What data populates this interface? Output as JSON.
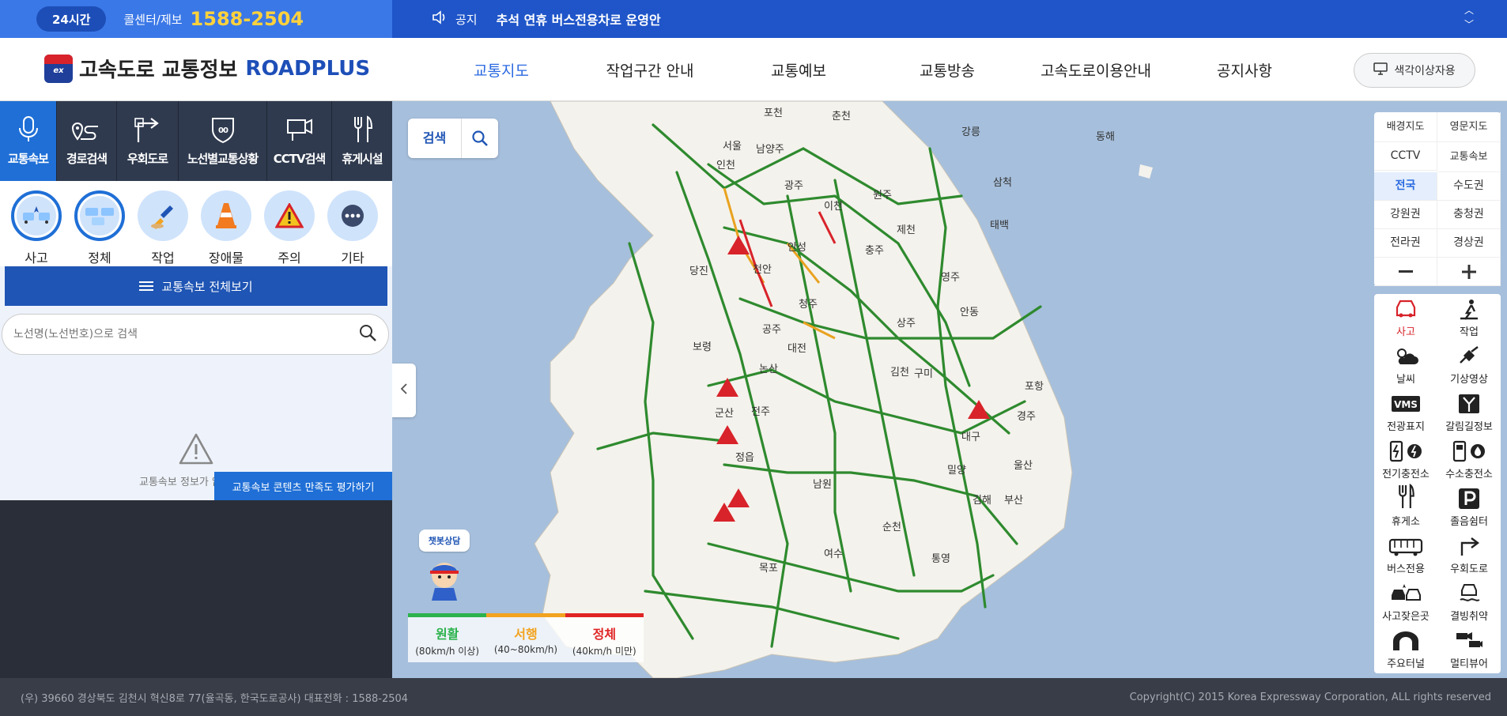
{
  "topbar": {
    "badge": "24시간",
    "callcenter_label": "콜센터/제보",
    "phone": "1588-2504",
    "notice_label": "공지",
    "notice_text": "추석 연휴 버스전용차로 운영안"
  },
  "header": {
    "logo_text": "고속도로 교통정보",
    "logo_brand": "ROADPLUS",
    "logo_emblem": "ex",
    "nav": [
      "교통지도",
      "작업구간 안내",
      "교통예보",
      "교통방송",
      "고속도로이용안내",
      "공지사항"
    ],
    "colorblind_label": "색각이상자용"
  },
  "sidebar": {
    "tools": [
      {
        "label": "교통속보",
        "icon": "microphone-icon"
      },
      {
        "label": "경로검색",
        "icon": "route-icon"
      },
      {
        "label": "우회도로",
        "icon": "detour-icon"
      },
      {
        "label": "노선별교통상황",
        "icon": "highway-shield-icon"
      },
      {
        "label": "CCTV검색",
        "icon": "cctv-icon"
      },
      {
        "label": "휴게시설",
        "icon": "fork-knife-icon"
      }
    ],
    "categories": [
      "사고",
      "정체",
      "작업",
      "장애물",
      "주의",
      "기타"
    ],
    "fullview_label": "교통속보 전체보기",
    "search_placeholder": "노선명(노선번호)으로 검색",
    "empty_text": "교통속보 정보가 없습니다.",
    "rate_label": "교통속보 콘텐츠 만족도 평가하기"
  },
  "map": {
    "search_label": "검색",
    "chatbot_label": "챗봇상담",
    "labels": [
      "포천",
      "춘천",
      "강릉",
      "동해",
      "서울",
      "남양주",
      "인천",
      "광주",
      "이천",
      "원주",
      "삼척",
      "태백",
      "제천",
      "안성",
      "충주",
      "당진",
      "천안",
      "영주",
      "청주",
      "안동",
      "상주",
      "보령",
      "공주",
      "대전",
      "논산",
      "김천",
      "구미",
      "포항",
      "군산",
      "전주",
      "경주",
      "정읍",
      "대구",
      "밀양",
      "울산",
      "김해",
      "부산",
      "남원",
      "순천",
      "여수",
      "통영",
      "목포",
      "광주2"
    ],
    "legend": [
      {
        "title": "원활",
        "sub": "(80km/h 이상)",
        "color": "#2bb24c"
      },
      {
        "title": "서행",
        "sub": "(40~80km/h)",
        "color": "#f2a31f"
      },
      {
        "title": "정체",
        "sub": "(40km/h 미만)",
        "color": "#e02424"
      }
    ],
    "controls": [
      "배경지도",
      "영문지도",
      "CCTV",
      "교통속보",
      "전국",
      "수도권",
      "강원권",
      "충청권",
      "전라권",
      "경상권"
    ],
    "layers": [
      "사고",
      "작업",
      "날씨",
      "기상영상",
      "전광표지",
      "갈림길정보",
      "전기충전소",
      "수소충전소",
      "휴게소",
      "졸음쉼터",
      "버스전용",
      "우회도로",
      "사고잦은곳",
      "결빙취약",
      "주요터널",
      "멀티뷰어"
    ]
  },
  "footer": {
    "address": "(우) 39660 경상북도 김천시 혁신8로 77(율곡동, 한국도로공사) 대표전화 : 1588-2504",
    "copyright": "Copyright(C) 2015 Korea Expressway Corporation, ALL rights reserved"
  }
}
